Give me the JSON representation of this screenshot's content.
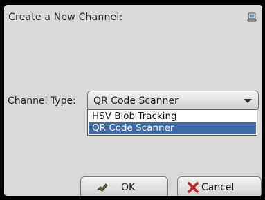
{
  "dialog": {
    "title": "Create a New Channel:",
    "title_icon": "network-icon"
  },
  "channel_type": {
    "label": "Channel Type:",
    "selected": "QR Code Scanner",
    "options": [
      {
        "label": "HSV Blob Tracking",
        "highlighted": false
      },
      {
        "label": "QR Code Scanner",
        "highlighted": true
      }
    ]
  },
  "buttons": {
    "ok_label": "OK",
    "ok_icon": "ok-hand-icon",
    "cancel_label": "Cancel",
    "cancel_icon": "red-x-icon"
  },
  "colors": {
    "highlight": "#3d6aa8",
    "background": "#d9dad8",
    "cancel_x": "#c62020"
  }
}
